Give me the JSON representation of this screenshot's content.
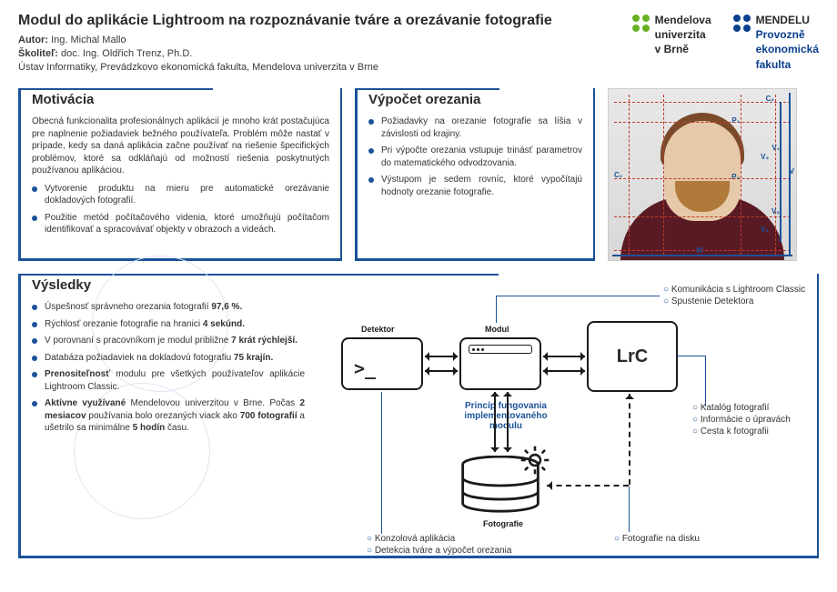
{
  "header": {
    "title": "Modul do aplikácie Lightroom na rozpoznávanie tváre a orezávanie fotografie",
    "author_label": "Autor:",
    "author": "Ing. Michal Mallo",
    "supervisor_label": "Školiteľ:",
    "supervisor": "doc. Ing. Oldřich Trenz, Ph.D.",
    "affiliation": "Ústav Informatiky, Prevádzkovo ekonomická fakulta, Mendelova univerzita v Brne"
  },
  "logo": {
    "left1": "Mendelova",
    "left2": "univerzita",
    "left3": "v Brně",
    "right1": "MENDELU",
    "right2": "Provozně",
    "right3": "ekonomická",
    "right4": "fakulta"
  },
  "motivation": {
    "heading": "Motivácia",
    "para": "Obecná funkcionalita profesionálnych aplikácií je mnoho krát postačujúca pre naplnenie požiadaviek bežného používateľa. Problém môže nastať v prípade, kedy sa daná aplikácia začne používať na riešenie špecifických problémov, ktoré sa odkláňajú od možností riešenia poskytnutých používanou aplikáciou.",
    "b1": "Vytvorenie produktu na mieru pre automatické orezávanie dokladových fotografií.",
    "b2": "Použitie metód počítačového videnia, ktoré umožňujú počítačom identifikovať a spracovávať objekty v obrazoch a videách."
  },
  "crop": {
    "heading": "Výpočet orezania",
    "b1": "Požiadavky na orezanie fotografie sa líšia v závislosti od krajiny.",
    "b2": "Pri výpočte orezania vstupuje trinásť parametrov do matematického odvodzovania.",
    "b3": "Výstupom je sedem rovníc, ktoré vypočítajú hodnoty orezanie fotografie."
  },
  "results": {
    "heading": "Výsledky",
    "b1a": "Úspešnosť správneho orezania fotografií ",
    "b1b": "97,6 %.",
    "b2a": "Rýchlosť orezanie fotografie na hranici ",
    "b2b": "4 sekúnd.",
    "b3a": "V porovnaní s pracovníkom je modul približne ",
    "b3b": "7 krát rýchlejší.",
    "b4a": "Databáza požiadaviek na dokladovú fotografiu ",
    "b4b": "75 krajín.",
    "b5a": "Prenositeľnosť",
    "b5b": " modulu pre všetkých používateľov aplikácie Lightroom Classic.",
    "b6a": "Aktívne využívané",
    "b6b": " Mendelovou univerzitou v Brne. Počas ",
    "b6c": "2 mesiacov",
    "b6d": " používania bolo orezaných viack ako ",
    "b6e": "700 fotografií",
    "b6f": " a ušetrilo sa minimálne ",
    "b6g": "5 hodín",
    "b6h": " času."
  },
  "diagram": {
    "detektor": "Detektor",
    "modul": "Modul",
    "lrc": "LrC",
    "fotografie": "Fotografie",
    "principle1": "Princíp fungovania",
    "principle2": "implementovaného",
    "principle3": "modulu",
    "ann_top1": "Komunikácia s Lightroom Classic",
    "ann_top2": "Spustenie Detektora",
    "ann_right1": "Katalóg fotografií",
    "ann_right2": "Informácie o úpravách",
    "ann_right3": "Cesta k fotografii",
    "ann_bl1": "Konzolová aplikácia",
    "ann_bl2": "Detekcia tváre a výpočet orezania",
    "ann_br": "Fotografie na disku"
  },
  "photo_labels": {
    "p1": "P₁",
    "p2": "P₂",
    "c1": "C₁",
    "c2": "C₂",
    "v": "V",
    "v1": "V₁",
    "v2": "V₂",
    "v3": "V₃",
    "v4": "V₄",
    "w": "W"
  }
}
